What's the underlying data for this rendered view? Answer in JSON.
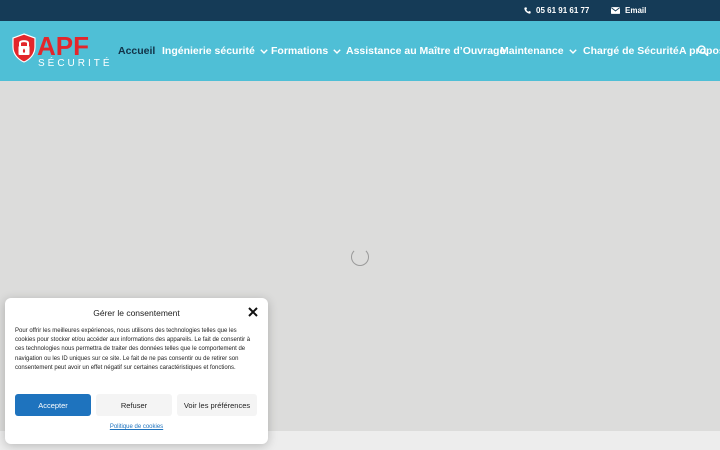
{
  "topbar": {
    "phone": "05 61 91 61 77",
    "email": "Email",
    "phone_icon": "phone-icon",
    "email_icon": "envelope-icon",
    "bg_color": "#153b57"
  },
  "brand": {
    "name": "APF",
    "subtitle": "SÉCURITÉ",
    "logo_icon": "shield-lock-icon",
    "primary_color": "#e3262b"
  },
  "nav": {
    "bg_color": "#4fbfd6",
    "items": [
      {
        "label": "Accueil",
        "has_dropdown": false,
        "active": true
      },
      {
        "label": "Ingénierie sécurité",
        "has_dropdown": true,
        "active": false
      },
      {
        "label": "Formations",
        "has_dropdown": true,
        "active": false
      },
      {
        "label": "Assistance au Maître d’Ouvrage",
        "has_dropdown": false,
        "active": false
      },
      {
        "label": "Maintenance",
        "has_dropdown": true,
        "active": false
      },
      {
        "label": "Chargé de Sécurité",
        "has_dropdown": false,
        "active": false
      },
      {
        "label": "A propos",
        "has_dropdown": false,
        "active": false
      }
    ],
    "search_icon": "search-icon"
  },
  "main": {
    "loading_icon": "spinner-icon"
  },
  "consent": {
    "title": "Gérer le consentement",
    "body": "Pour offrir les meilleures expériences, nous utilisons des technologies telles que les cookies pour stocker et/ou accéder aux informations des appareils. Le fait de consentir à ces technologies nous permettra de traiter des données telles que le comportement de navigation ou les ID uniques sur ce site. Le fait de ne pas consentir ou de retirer son consentement peut avoir un effet négatif sur certaines caractéristiques et fonctions.",
    "accept": "Accepter",
    "refuse": "Refuser",
    "preferences": "Voir les préférences",
    "policy": "Politique de cookies",
    "close_icon": "close-icon",
    "accent_color": "#1e73be"
  }
}
